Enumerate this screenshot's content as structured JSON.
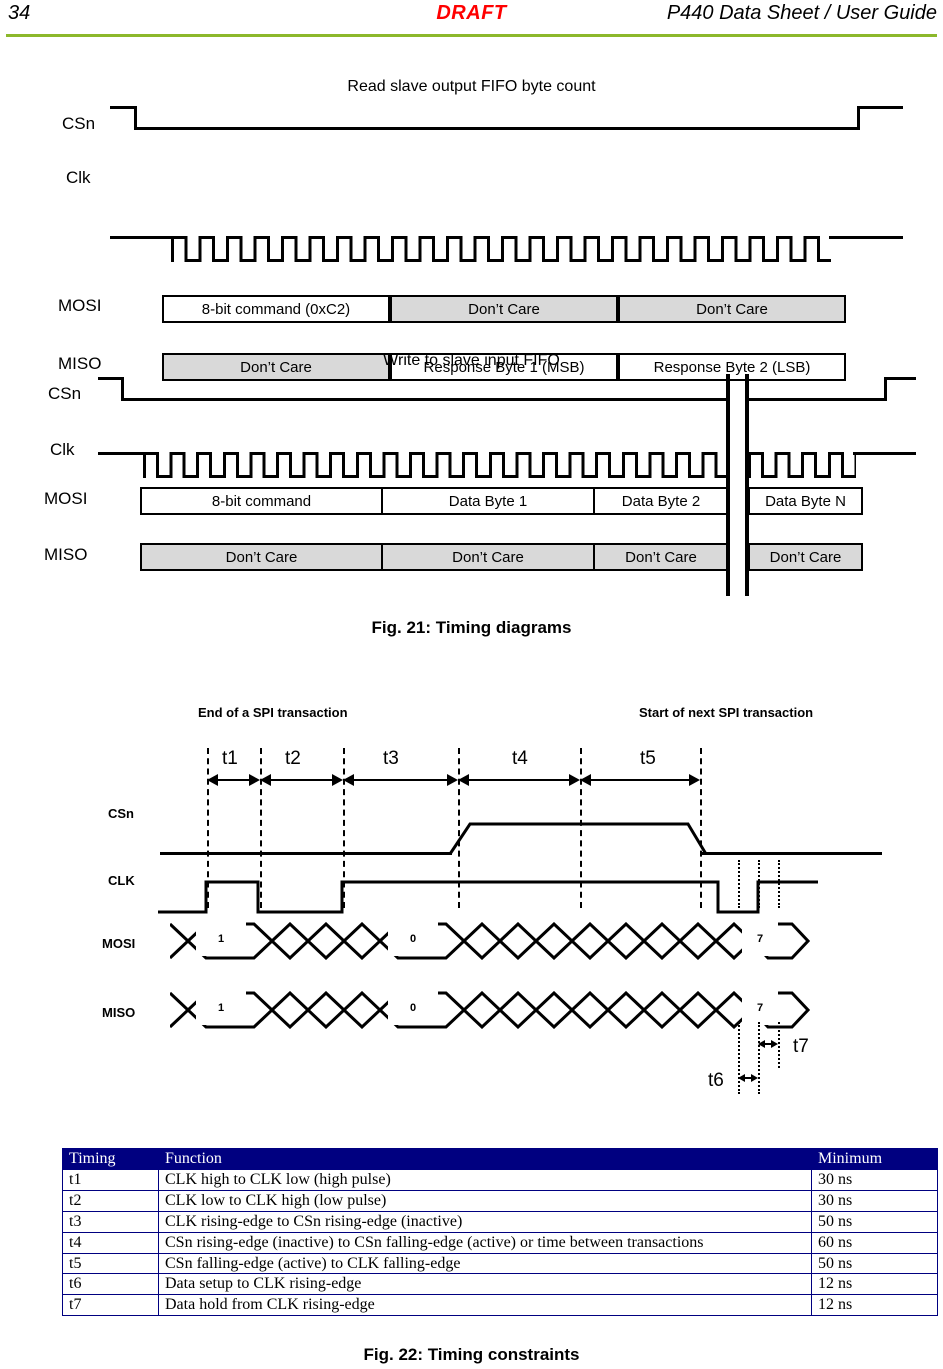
{
  "header": {
    "page_number": "34",
    "watermark": "DRAFT",
    "title": "P440 Data Sheet / User Guide",
    "rule_color": "#8cb82b",
    "watermark_color": "#ff0000"
  },
  "fig21": {
    "caption": "Fig. 21: Timing diagrams",
    "diagrams": [
      {
        "title": "Read slave output FIFO byte count",
        "signals": {
          "csn": "CSn",
          "clk": "Clk",
          "mosi": "MOSI",
          "miso": "MISO"
        },
        "mosi_cells": [
          {
            "label": "8-bit command (0xC2)",
            "style": "plain"
          },
          {
            "label": "Don’t Care",
            "style": "dontcare"
          },
          {
            "label": "Don’t Care",
            "style": "dontcare"
          }
        ],
        "miso_cells": [
          {
            "label": "Don’t Care",
            "style": "dontcare"
          },
          {
            "label": "Response Byte 1 (MSB)",
            "style": "plain"
          },
          {
            "label": "Response Byte 2 (LSB)",
            "style": "plain"
          }
        ],
        "clock_cycles": 24
      },
      {
        "title": "Write to slave input FIFO",
        "signals": {
          "csn": "CSn",
          "clk": "Clk",
          "mosi": "MOSI",
          "miso": "MISO"
        },
        "mosi_cells": [
          {
            "label": "8-bit command",
            "style": "plain"
          },
          {
            "label": "Data Byte 1",
            "style": "plain"
          },
          {
            "label": "Data Byte 2",
            "style": "plain"
          },
          {
            "label": "Data Byte N",
            "style": "plain"
          }
        ],
        "miso_cells": [
          {
            "label": "Don’t Care",
            "style": "dontcare"
          },
          {
            "label": "Don’t Care",
            "style": "dontcare"
          },
          {
            "label": "Don’t Care",
            "style": "dontcare"
          },
          {
            "label": "Don’t Care",
            "style": "dontcare"
          }
        ],
        "clock_cycles": 22,
        "clock_cycles_after_break": 4,
        "has_break": true
      }
    ]
  },
  "fig22": {
    "caption": "Fig. 22: Timing constraints",
    "annotations": {
      "left": "End of a SPI transaction",
      "right": "Start of next SPI transaction"
    },
    "signals": {
      "csn": "CSn",
      "clk": "CLK",
      "mosi": "MOSI",
      "miso": "MISO"
    },
    "interval_markers": [
      "t1",
      "t2",
      "t3",
      "t4",
      "t5"
    ],
    "detail_markers": {
      "setup": "t6",
      "hold": "t7"
    },
    "mosi_bits": [
      "1",
      "0",
      "7"
    ],
    "miso_bits": [
      "1",
      "0",
      "7"
    ]
  },
  "table": {
    "headers": [
      "Timing",
      "Function",
      "Minimum"
    ],
    "header_bg": "#000080",
    "rows": [
      [
        "t1",
        "CLK high to CLK low (high pulse)",
        "30 ns"
      ],
      [
        "t2",
        "CLK low to CLK high (low pulse)",
        "30 ns"
      ],
      [
        "t3",
        "CLK rising-edge to CSn rising-edge (inactive)",
        "50 ns"
      ],
      [
        "t4",
        "CSn rising-edge (inactive) to CSn falling-edge (active) or time between transactions",
        "60 ns"
      ],
      [
        "t5",
        "CSn falling-edge (active) to CLK falling-edge",
        "50 ns"
      ],
      [
        "t6",
        "Data setup to CLK rising-edge",
        "12 ns"
      ],
      [
        "t7",
        "Data hold from CLK rising-edge",
        "12 ns"
      ]
    ]
  }
}
